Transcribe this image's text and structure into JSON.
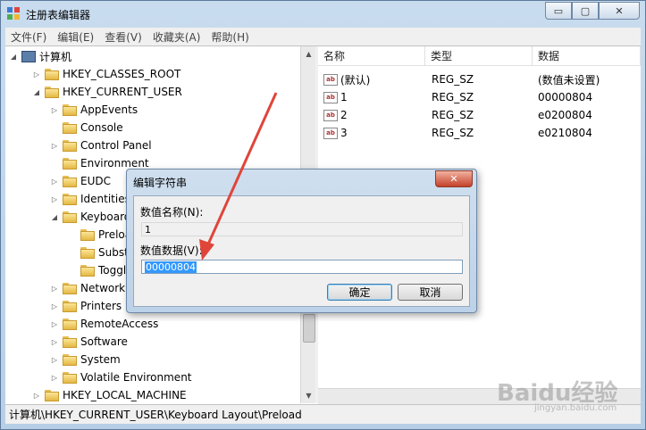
{
  "window": {
    "title": "注册表编辑器",
    "buttons": {
      "minimize": "▭",
      "maximize": "▢",
      "close": "✕"
    }
  },
  "menu": [
    "文件(F)",
    "编辑(E)",
    "查看(V)",
    "收藏夹(A)",
    "帮助(H)"
  ],
  "tree": {
    "root": "计算机",
    "items": [
      {
        "label": "HKEY_CLASSES_ROOT",
        "expander": "▷"
      },
      {
        "label": "HKEY_CURRENT_USER",
        "expander": "◢"
      },
      {
        "label": "AppEvents",
        "expander": "▷"
      },
      {
        "label": "Console",
        "expander": ""
      },
      {
        "label": "Control Panel",
        "expander": "▷"
      },
      {
        "label": "Environment",
        "expander": ""
      },
      {
        "label": "EUDC",
        "expander": "▷"
      },
      {
        "label": "Identities",
        "expander": "▷"
      },
      {
        "label": "Keyboard Layout",
        "expander": "◢"
      },
      {
        "label": "Preload",
        "expander": ""
      },
      {
        "label": "Substitutes",
        "expander": ""
      },
      {
        "label": "Toggle",
        "expander": ""
      },
      {
        "label": "Network",
        "expander": "▷"
      },
      {
        "label": "Printers",
        "expander": "▷"
      },
      {
        "label": "RemoteAccess",
        "expander": "▷"
      },
      {
        "label": "Software",
        "expander": "▷"
      },
      {
        "label": "System",
        "expander": "▷"
      },
      {
        "label": "Volatile Environment",
        "expander": "▷"
      },
      {
        "label": "HKEY_LOCAL_MACHINE",
        "expander": "▷"
      }
    ]
  },
  "list": {
    "headers": [
      "名称",
      "类型",
      "数据"
    ],
    "rows": [
      {
        "name": "(默认)",
        "type": "REG_SZ",
        "data": "(数值未设置)",
        "icon": "ab"
      },
      {
        "name": "1",
        "type": "REG_SZ",
        "data": "00000804",
        "icon": "ab"
      },
      {
        "name": "2",
        "type": "REG_SZ",
        "data": "e0200804",
        "icon": "ab"
      },
      {
        "name": "3",
        "type": "REG_SZ",
        "data": "e0210804",
        "icon": "ab"
      }
    ]
  },
  "status": "计算机\\HKEY_CURRENT_USER\\Keyboard Layout\\Preload",
  "dialog": {
    "title": "编辑字符串",
    "close": "✕",
    "name_label": "数值名称(N):",
    "name_value": "1",
    "data_label": "数值数据(V):",
    "data_value": "00000804",
    "ok": "确定",
    "cancel": "取消"
  },
  "watermark": {
    "text": "Baidu经验",
    "sub": "jingyan.baidu.com"
  },
  "colors": {
    "annotation_arrow": "#e0453a",
    "selection": "#3399ff"
  }
}
